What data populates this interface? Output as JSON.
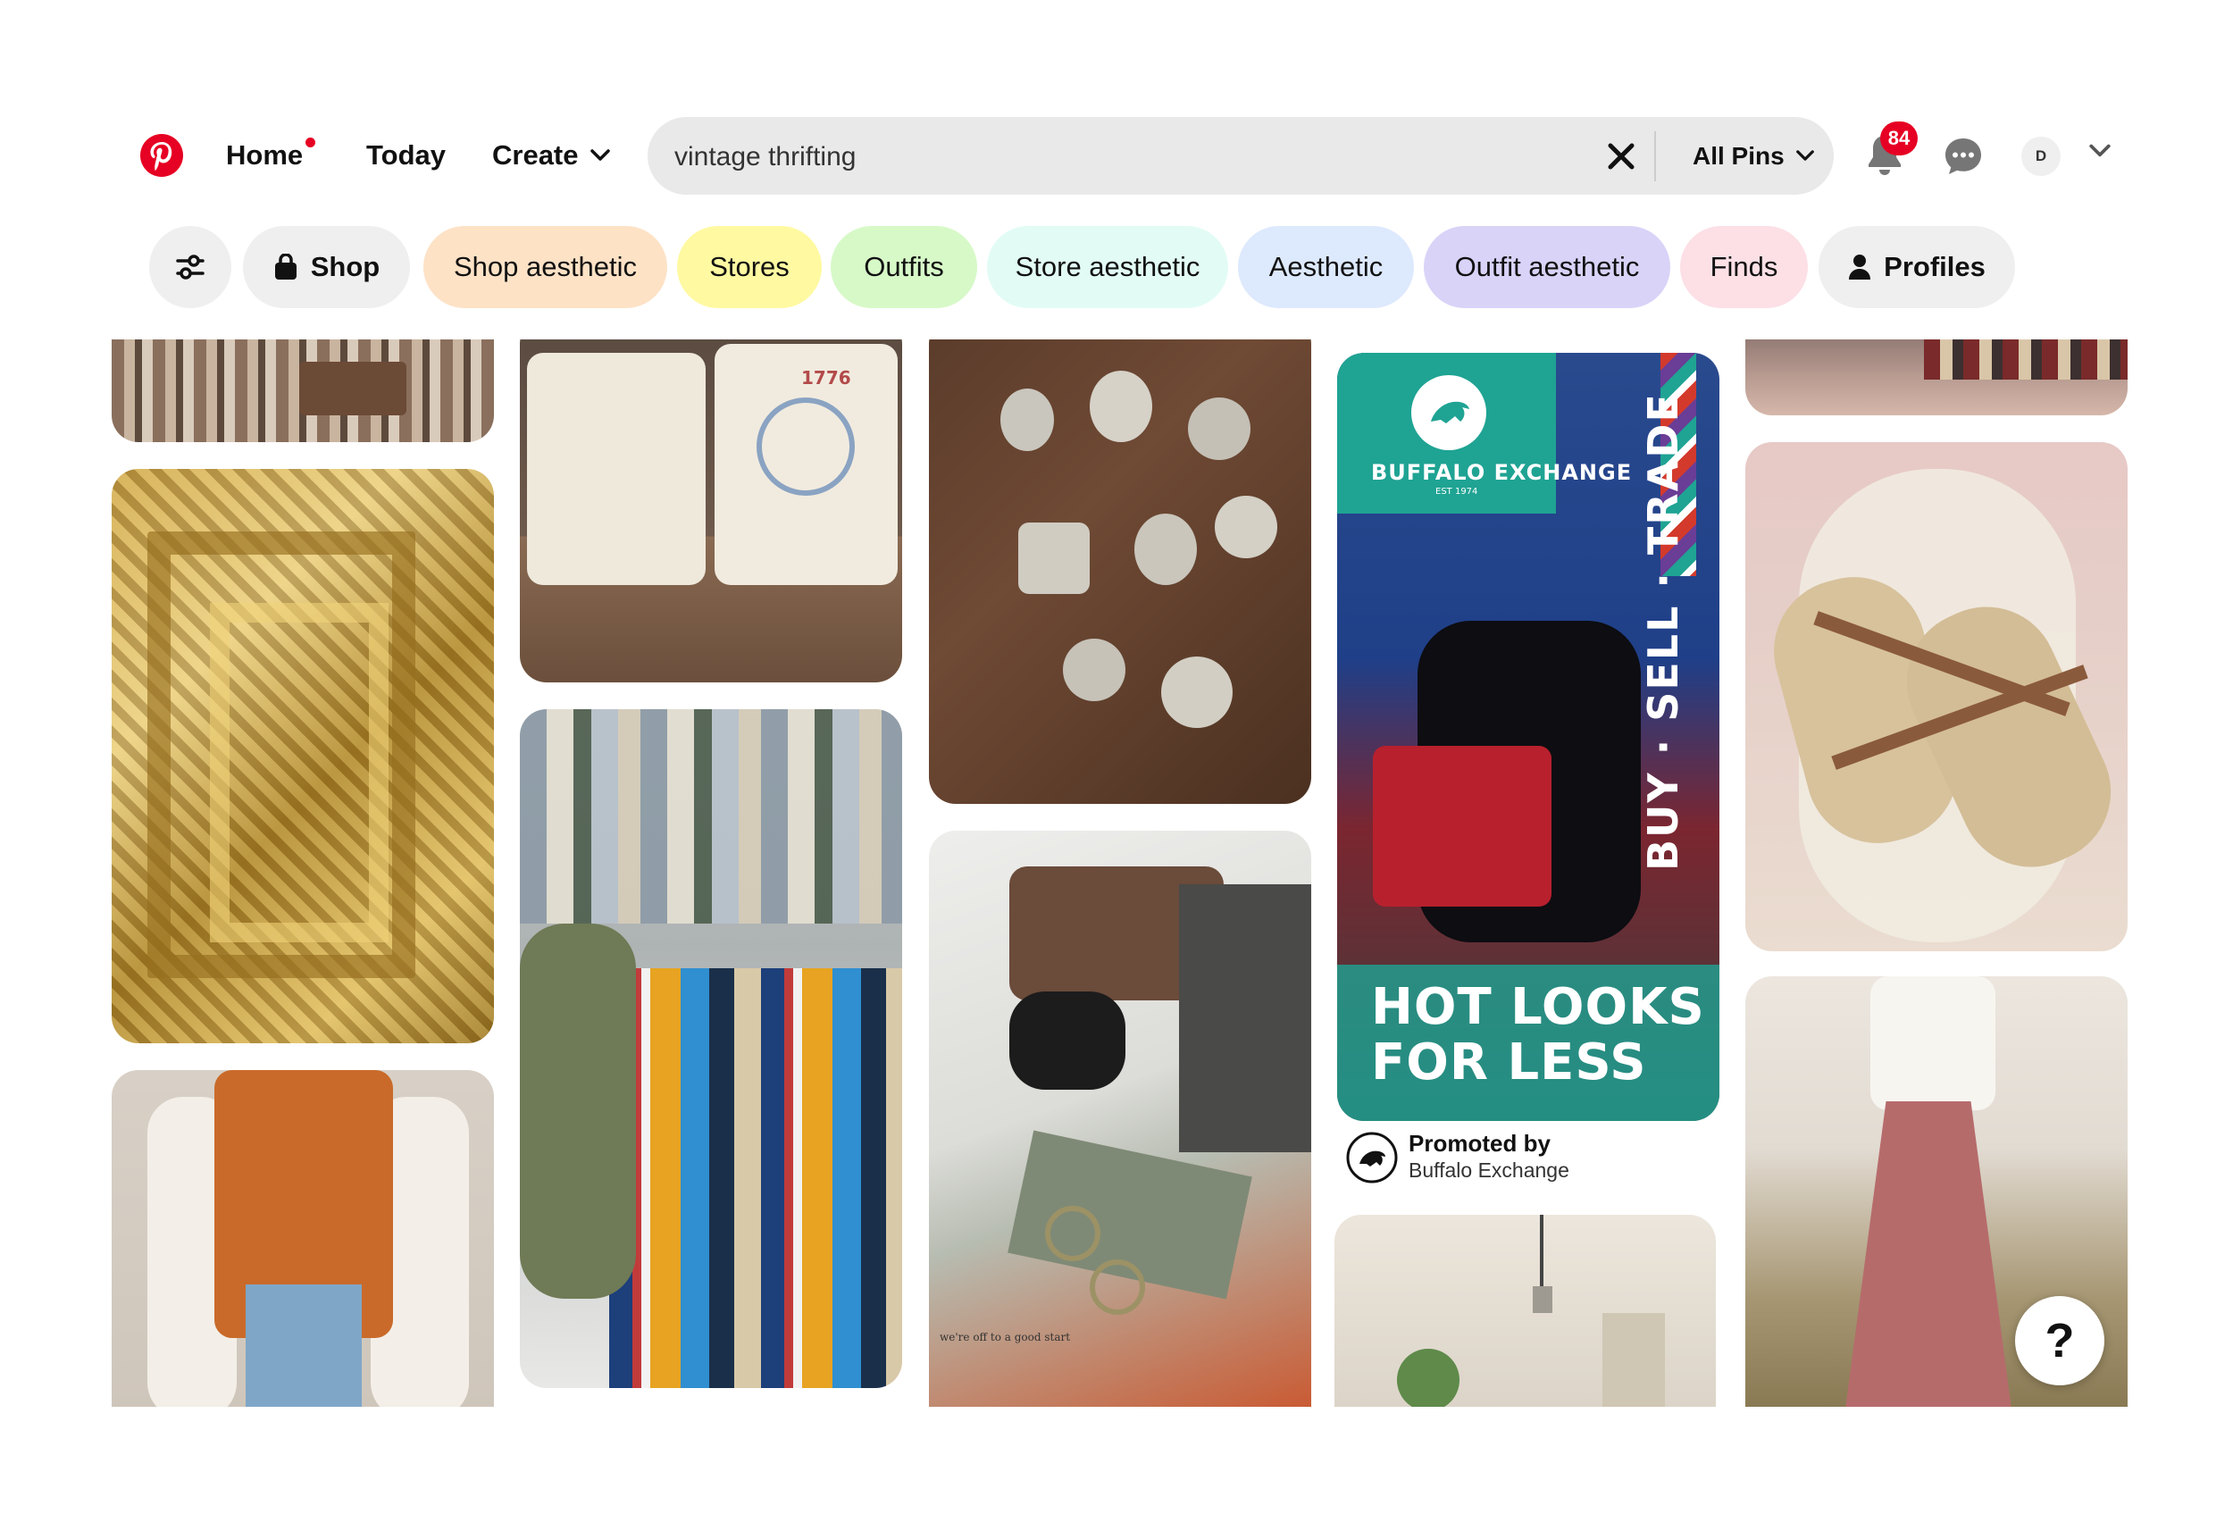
{
  "nav": {
    "home": "Home",
    "today": "Today",
    "create": "Create"
  },
  "search": {
    "value": "vintage thrifting",
    "scope": "All Pins"
  },
  "notifications": {
    "count": "84"
  },
  "account": {
    "initial": "D"
  },
  "filters": {
    "shop": "Shop",
    "chips": [
      {
        "label": "Shop aesthetic",
        "color": "#fde2c6"
      },
      {
        "label": "Stores",
        "color": "#fff9a1"
      },
      {
        "label": "Outfits",
        "color": "#d7f9c8"
      },
      {
        "label": "Store aesthetic",
        "color": "#e2fcf5"
      },
      {
        "label": "Aesthetic",
        "color": "#dde9fd"
      },
      {
        "label": "Outfit aesthetic",
        "color": "#d9d3f8"
      },
      {
        "label": "Finds",
        "color": "#fce0e6"
      }
    ],
    "profiles": "Profiles"
  },
  "promoted": {
    "brand_logo_text": "BUFFALO EXCHANGE",
    "brand_tag": "EST 1974",
    "vertical_text": "BUY · SELL · TRADE",
    "headline_1": "HOT LOOKS",
    "headline_2": "FOR LESS",
    "label": "Promoted by",
    "advertiser": "Buffalo Exchange"
  },
  "pin_captions": {
    "jacket_year": "1776",
    "good_start": "we're off to a good start"
  },
  "help": {
    "label": "?"
  },
  "colors": {
    "brand": "#e60023",
    "search_bg": "#e9e9e9",
    "chip_neutral": "#efefef"
  }
}
